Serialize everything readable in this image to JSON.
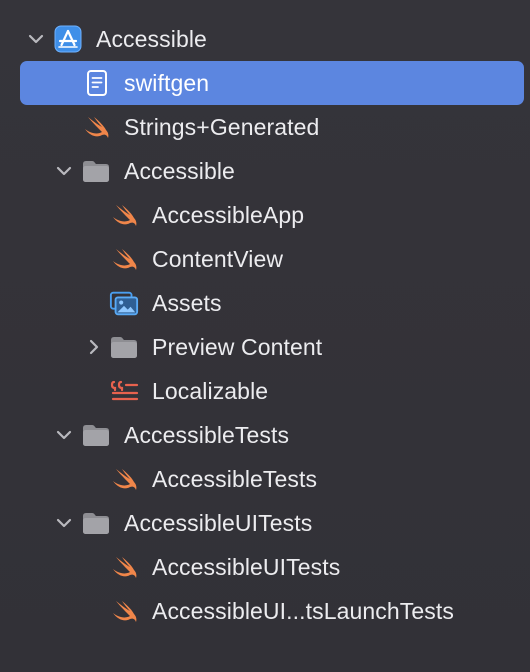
{
  "navigator": {
    "items": [
      {
        "label": "Accessible",
        "kind": "project",
        "icon": "xcode-project-icon",
        "disclosure": "expanded",
        "selected": false
      },
      {
        "label": "swiftgen",
        "kind": "file",
        "icon": "document-icon",
        "disclosure": "none",
        "selected": true
      },
      {
        "label": "Strings+Generated",
        "kind": "swift",
        "icon": "swift-icon",
        "disclosure": "none",
        "selected": false
      },
      {
        "label": "Accessible",
        "kind": "folder",
        "icon": "folder-icon",
        "disclosure": "expanded",
        "selected": false
      },
      {
        "label": "AccessibleApp",
        "kind": "swift",
        "icon": "swift-icon",
        "disclosure": "none",
        "selected": false
      },
      {
        "label": "ContentView",
        "kind": "swift",
        "icon": "swift-icon",
        "disclosure": "none",
        "selected": false
      },
      {
        "label": "Assets",
        "kind": "assets",
        "icon": "asset-catalog-icon",
        "disclosure": "none",
        "selected": false
      },
      {
        "label": "Preview Content",
        "kind": "folder",
        "icon": "folder-icon",
        "disclosure": "collapsed",
        "selected": false
      },
      {
        "label": "Localizable",
        "kind": "strings",
        "icon": "strings-file-icon",
        "disclosure": "none",
        "selected": false
      },
      {
        "label": "AccessibleTests",
        "kind": "folder",
        "icon": "folder-icon",
        "disclosure": "expanded",
        "selected": false
      },
      {
        "label": "AccessibleTests",
        "kind": "swift",
        "icon": "swift-icon",
        "disclosure": "none",
        "selected": false
      },
      {
        "label": "AccessibleUITests",
        "kind": "folder",
        "icon": "folder-icon",
        "disclosure": "expanded",
        "selected": false
      },
      {
        "label": "AccessibleUITests",
        "kind": "swift",
        "icon": "swift-icon",
        "disclosure": "none",
        "selected": false
      },
      {
        "label": "AccessibleUI...tsLaunchTests",
        "kind": "swift",
        "icon": "swift-icon",
        "disclosure": "none",
        "selected": false
      }
    ]
  },
  "colors": {
    "background": "#333238",
    "selection": "#5c86e0",
    "swift_orange": "#f0864a",
    "folder_gray": "#8e8e93",
    "project_blue": "#4a9ff0",
    "strings_red": "#e8624e"
  }
}
